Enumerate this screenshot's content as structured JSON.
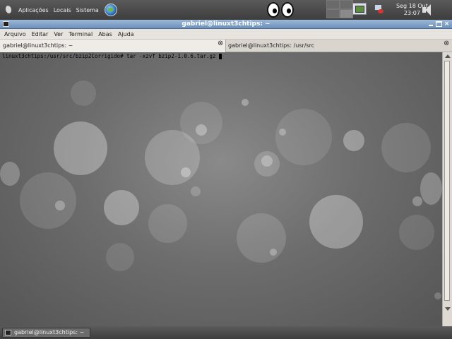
{
  "top_panel": {
    "menus": [
      "Aplicações",
      "Locais",
      "Sistema"
    ],
    "clock_day": "Seg 18 Out",
    "clock_time": "23:07"
  },
  "window": {
    "title": "gabriel@linuxt3chtips: ~",
    "menu": [
      "Arquivo",
      "Editar",
      "Ver",
      "Terminal",
      "Abas",
      "Ajuda"
    ],
    "tabs": [
      {
        "label": "gabriel@linuxt3chtips: ~",
        "active": true
      },
      {
        "label": "gabriel@linuxt3chtips: /usr/src",
        "active": false
      }
    ],
    "command_line": "linuxt3chtips:/usr/src/bzip2Corrigido# tar -xzvf bzip2-1.0.6.tar.gz "
  },
  "bottom_panel": {
    "task_label": "gabriel@linuxt3chtips: ~"
  },
  "colors": {
    "titlebar": "#7f9fc5",
    "panel": "#4a4a4a"
  }
}
